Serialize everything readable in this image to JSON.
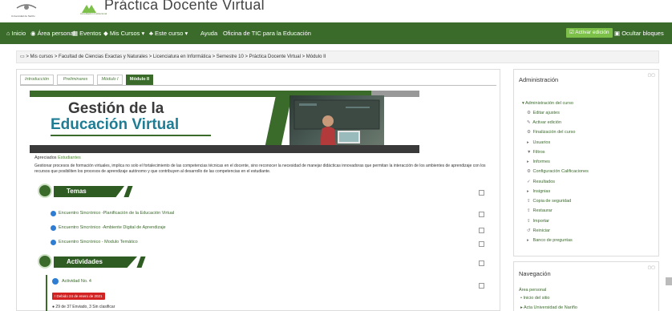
{
  "header": {
    "site_title": "Práctica Docente Virtual",
    "uni_logo_text": "Universidad de Nariño",
    "vd_logo_text": "Acreditación Institucional"
  },
  "navbar": {
    "items": [
      {
        "label": "Inicio",
        "icon": "home-icon"
      },
      {
        "label": "Área personal",
        "icon": "dashboard-icon"
      },
      {
        "label": "Eventos",
        "icon": "calendar-icon"
      },
      {
        "label": "Mis Cursos ▾",
        "icon": "courses-icon"
      },
      {
        "label": "Este curso ▾",
        "icon": "sitemap-icon"
      },
      {
        "label": "Ayuda"
      },
      {
        "label": "Oficina de TIC para la Educación"
      }
    ],
    "activar_edicion": "Activar edición",
    "ocultar_bloques": "Ocultar bloques"
  },
  "breadcrumb": "Mis cursos  >  Facultad de Ciencias Exactas y Naturales  >  Licenciatura en Informática  >  Semestre 10  >  Práctica Docente Virtual  >  Módulo II",
  "tabs": [
    {
      "label": "Introducción"
    },
    {
      "label": "Preliminares"
    },
    {
      "label": "Módulo I"
    },
    {
      "label": "Módulo II",
      "active": true
    }
  ],
  "banner": {
    "title_line1": "Gestión de la",
    "title_line2": "Educación Virtual"
  },
  "intro": {
    "greeting": "Apreciados",
    "greeting_emphasis": "Estudiantes",
    "text": "Gestionar procesos de formación virtuales, implica no solo el fortalecimiento de las competencias técnicas en el docente, sino reconocer la necesidad de manejar didácticas innovadoras que permitan la interacción de los ambientes de aprendizaje con los recursos que posibiliten los  procesos de aprendizaje autónomo y que contribuyen al desarrollo de las competencias en el estudiante."
  },
  "sections": {
    "temas": "Temas",
    "actividades": "Actividades"
  },
  "topics": [
    {
      "label": "Encuentro Sincrónico -Planificación de la Educación Virtual"
    },
    {
      "label": "Encuentro Sincrónico -Ambiente Digital de Aprendizaje"
    },
    {
      "label": "Encuentro Sincrónico - Modulo Temático"
    }
  ],
  "activity": {
    "label": "Actividad No. 4",
    "due": "Debido 24 de enero de 2021",
    "status": "29 de 37 Enviado, 3 Sin clasificar"
  },
  "admin": {
    "title": "Administración",
    "root": "Administración del curso",
    "items": [
      {
        "label": "Editar ajustes",
        "icon": "gear-icon",
        "glyph": "⚙"
      },
      {
        "label": "Activar edición",
        "icon": "pencil-icon",
        "glyph": "✎"
      },
      {
        "label": "Finalización del curso",
        "icon": "gear-icon",
        "glyph": "⚙"
      },
      {
        "label": "Usuarios",
        "icon": "caret-right-icon",
        "glyph": "▸"
      },
      {
        "label": "Filtros",
        "icon": "filter-icon",
        "glyph": "▼"
      },
      {
        "label": "Informes",
        "icon": "caret-right-icon",
        "glyph": "▸"
      },
      {
        "label": "Configuración Calificaciones",
        "icon": "gear-icon",
        "glyph": "⚙"
      },
      {
        "label": "Resultados",
        "icon": "results-icon",
        "glyph": "✓"
      },
      {
        "label": "Insignias",
        "icon": "caret-right-icon",
        "glyph": "▸"
      },
      {
        "label": "Copia de seguridad",
        "icon": "upload-icon",
        "glyph": "⇪"
      },
      {
        "label": "Restaurar",
        "icon": "upload-icon",
        "glyph": "⇪"
      },
      {
        "label": "Importar",
        "icon": "upload-icon",
        "glyph": "⇪"
      },
      {
        "label": "Reiniciar",
        "icon": "reset-icon",
        "glyph": "↺"
      },
      {
        "label": "Banco de preguntas",
        "icon": "caret-right-icon",
        "glyph": "▸"
      }
    ]
  },
  "navigation": {
    "title": "Navegación",
    "area": "Área personal",
    "inicio": "Inicio del sitio",
    "partial": "Acta Universidad de Nariño"
  }
}
